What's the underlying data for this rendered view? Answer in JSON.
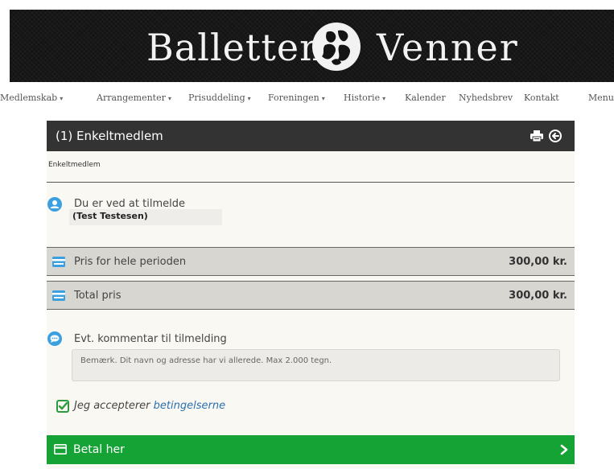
{
  "header": {
    "brand_left": "Ballettens",
    "brand_right": "Venner",
    "logo_icon": "dancers-logo-icon"
  },
  "nav": {
    "items": [
      {
        "label": "Medlemskab",
        "dropdown": true
      },
      {
        "label": "Arrangementer",
        "dropdown": true
      },
      {
        "label": "Prisuddeling",
        "dropdown": true
      },
      {
        "label": "Foreningen",
        "dropdown": true
      },
      {
        "label": "Historie",
        "dropdown": true
      },
      {
        "label": "Kalender",
        "dropdown": false
      },
      {
        "label": "Nyhedsbrev",
        "dropdown": false
      },
      {
        "label": "Kontakt",
        "dropdown": false
      },
      {
        "label": "Menu",
        "dropdown": false
      }
    ],
    "caret": "▾"
  },
  "panel": {
    "title": "(1) Enkeltmedlem",
    "subtitle": "Enkeltmedlem",
    "icons": {
      "print": "print-icon",
      "exit": "exit-icon"
    },
    "registrant": {
      "label": "Du er ved at tilmelde",
      "name": "(Test Testesen)"
    },
    "price_period": {
      "label": "Pris for hele perioden",
      "value": "300,00 kr."
    },
    "price_total": {
      "label": "Total pris",
      "value": "300,00 kr."
    },
    "comment": {
      "label": "Evt. kommentar til tilmelding",
      "placeholder": "Bemærk. Dit navn og adresse har vi allerede. Max 2.000 tegn.",
      "value": ""
    },
    "terms": {
      "prefix": "Jeg accepterer ",
      "link": "betingelserne",
      "checked": true
    },
    "pay_button": {
      "label": "Betal her"
    }
  },
  "colors": {
    "header_bg": "#141414",
    "panel_header_bg": "#333333",
    "price_row_bg": "#d8d6d1",
    "accent_blue": "#3aa0e0",
    "check_green": "#2e9a3e",
    "pay_green": "#14a334",
    "link_blue": "#2a6fb0"
  }
}
